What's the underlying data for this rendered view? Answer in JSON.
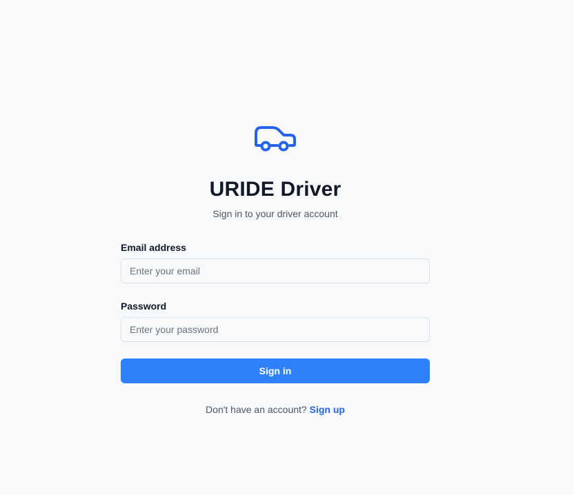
{
  "brand": {
    "logo_icon": "car-icon",
    "accent_color": "#2563eb",
    "title": "URIDE Driver",
    "subtitle": "Sign in to your driver account"
  },
  "form": {
    "email": {
      "label": "Email address",
      "value": "",
      "placeholder": "Enter your email"
    },
    "password": {
      "label": "Password",
      "value": "",
      "placeholder": "Enter your password"
    },
    "submit_label": "Sign in",
    "submit_color": "#2f80fb"
  },
  "footer": {
    "prompt": "Don't have an account?",
    "link_label": "Sign up"
  }
}
